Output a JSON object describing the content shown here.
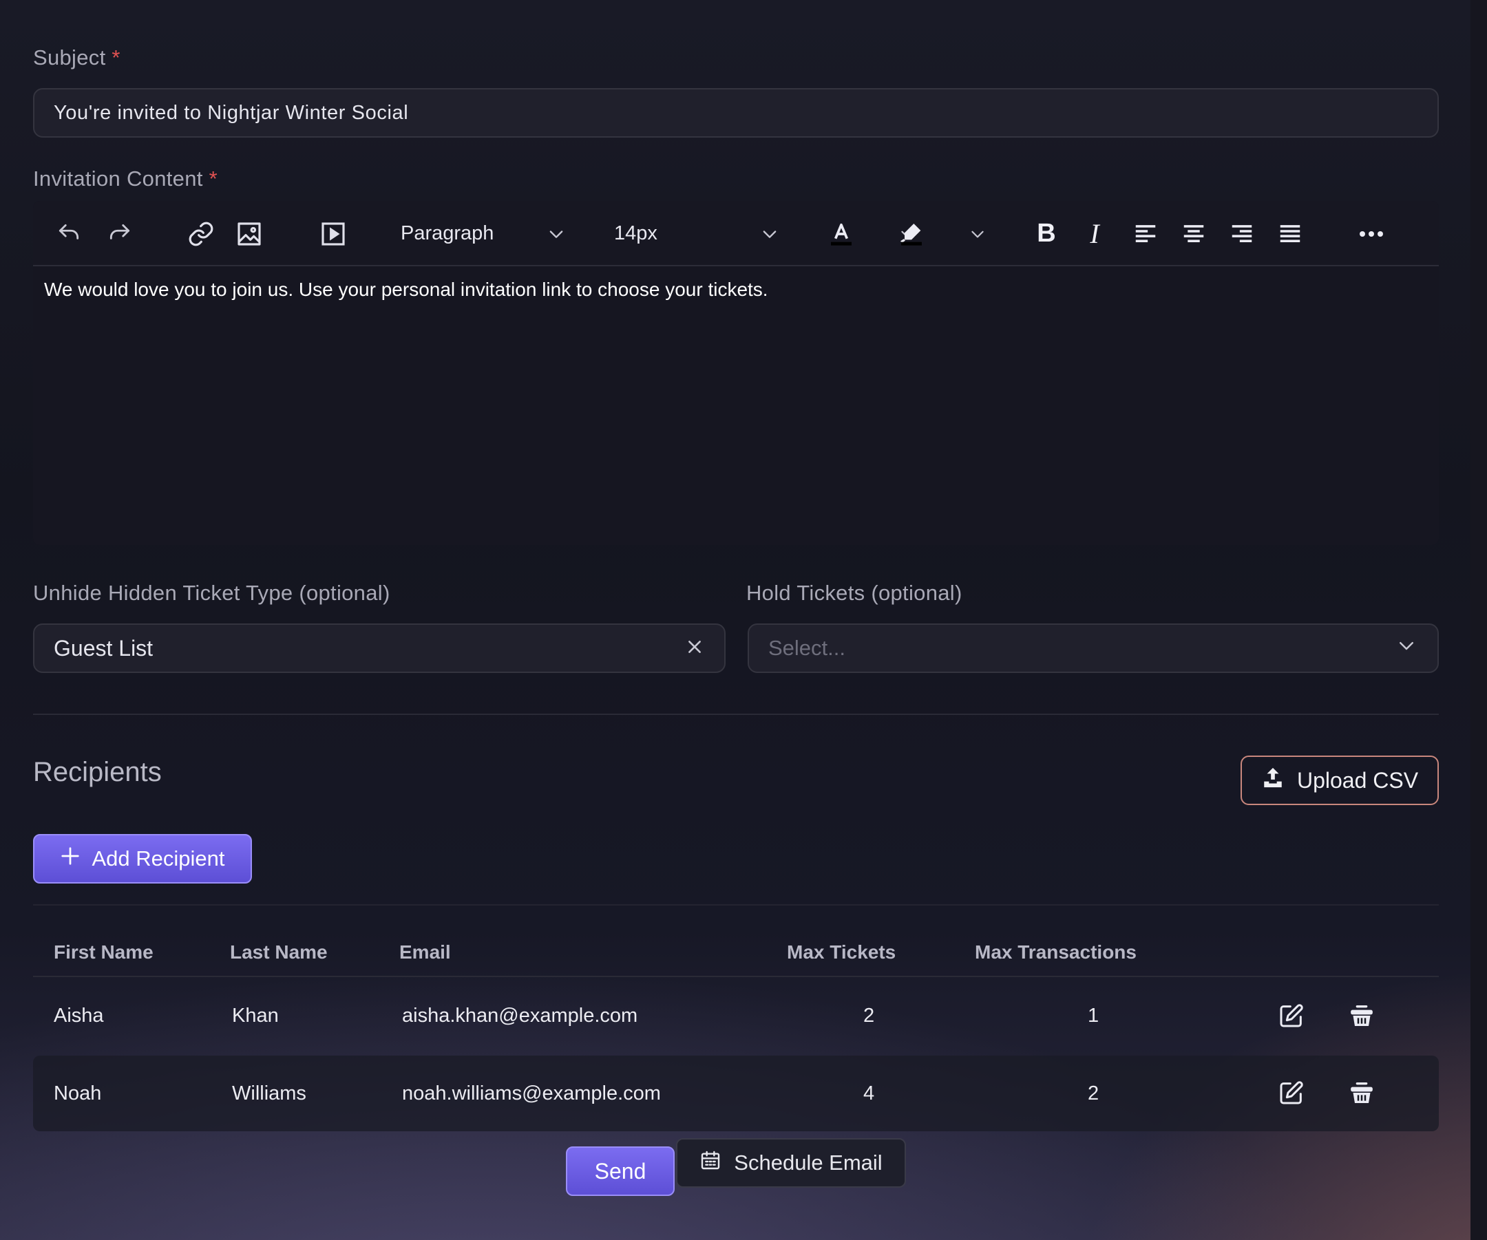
{
  "subject": {
    "label": "Subject",
    "required_mark": "*",
    "value": "You're invited to Nightjar Winter Social"
  },
  "invitation": {
    "label": "Invitation Content",
    "required_mark": "*",
    "toolbar": {
      "block_format": "Paragraph",
      "font_size": "14px",
      "icons": [
        "undo-icon",
        "redo-icon",
        "link-icon",
        "image-icon",
        "video-icon",
        "chevron-down-icon",
        "text-color-icon",
        "highlight-icon",
        "bold-icon",
        "italic-icon",
        "align-left-icon",
        "align-center-icon",
        "align-right-icon",
        "align-justify-icon",
        "more-icon"
      ]
    },
    "content": "We would love you to join us. Use your personal invitation link to choose your tickets."
  },
  "unhide": {
    "label": "Unhide Hidden Ticket Type (optional)",
    "value": "Guest List"
  },
  "hold": {
    "label": "Hold Tickets (optional)",
    "placeholder": "Select..."
  },
  "recipients": {
    "title": "Recipients",
    "upload_label": "Upload CSV",
    "add_label": "Add Recipient",
    "columns": [
      "First Name",
      "Last Name",
      "Email",
      "Max Tickets",
      "Max Transactions"
    ],
    "rows": [
      {
        "first": "Aisha",
        "last": "Khan",
        "email": "aisha.khan@example.com",
        "max_tickets": "2",
        "max_transactions": "1"
      },
      {
        "first": "Noah",
        "last": "Williams",
        "email": "noah.williams@example.com",
        "max_tickets": "4",
        "max_transactions": "2"
      }
    ]
  },
  "actions": {
    "send_label": "Send",
    "schedule_label": "Schedule Email"
  },
  "colors": {
    "accent": "#6a5ce6",
    "required": "#e05252",
    "upload_border": "#c9877d"
  }
}
